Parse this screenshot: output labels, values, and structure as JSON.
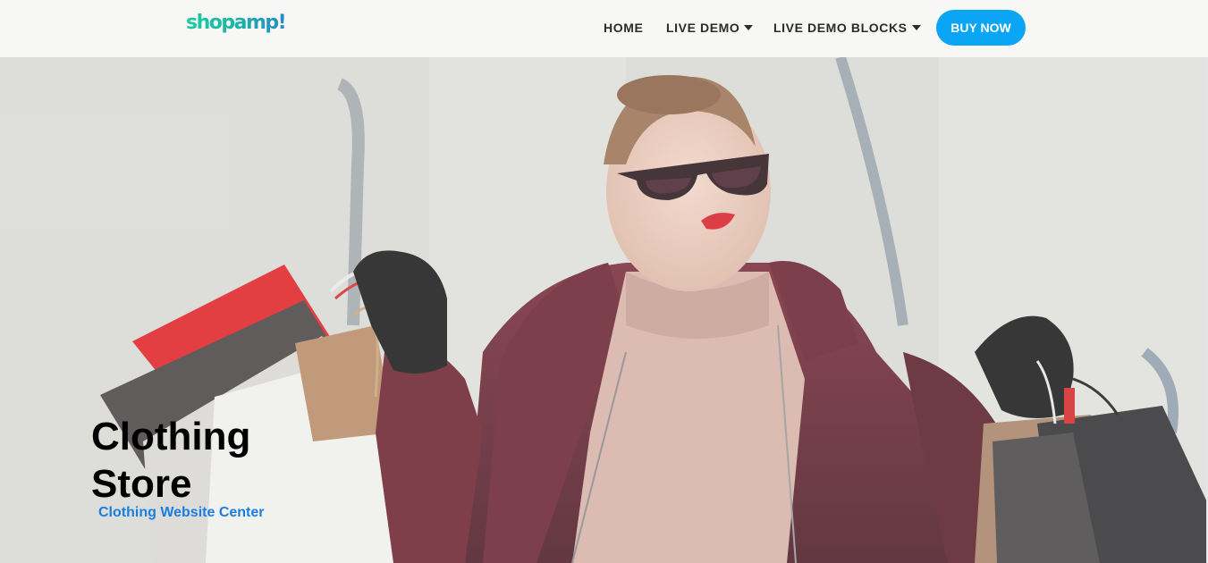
{
  "header": {
    "logo": "shopamp!",
    "nav": [
      {
        "label": "HOME"
      },
      {
        "label": "LIVE DEMO",
        "dropdown": true
      },
      {
        "label": "LIVE DEMO BLOCKS",
        "dropdown": true
      }
    ],
    "buy_label": "BUY NOW"
  },
  "hero": {
    "title": "Clothing Store",
    "subtitle": "Clothing Website Center"
  },
  "colors": {
    "accent": "#0aa5f5",
    "subtitle": "#1a7ee0",
    "logo_start": "#1fc9a0",
    "logo_end": "#2a88c9"
  }
}
